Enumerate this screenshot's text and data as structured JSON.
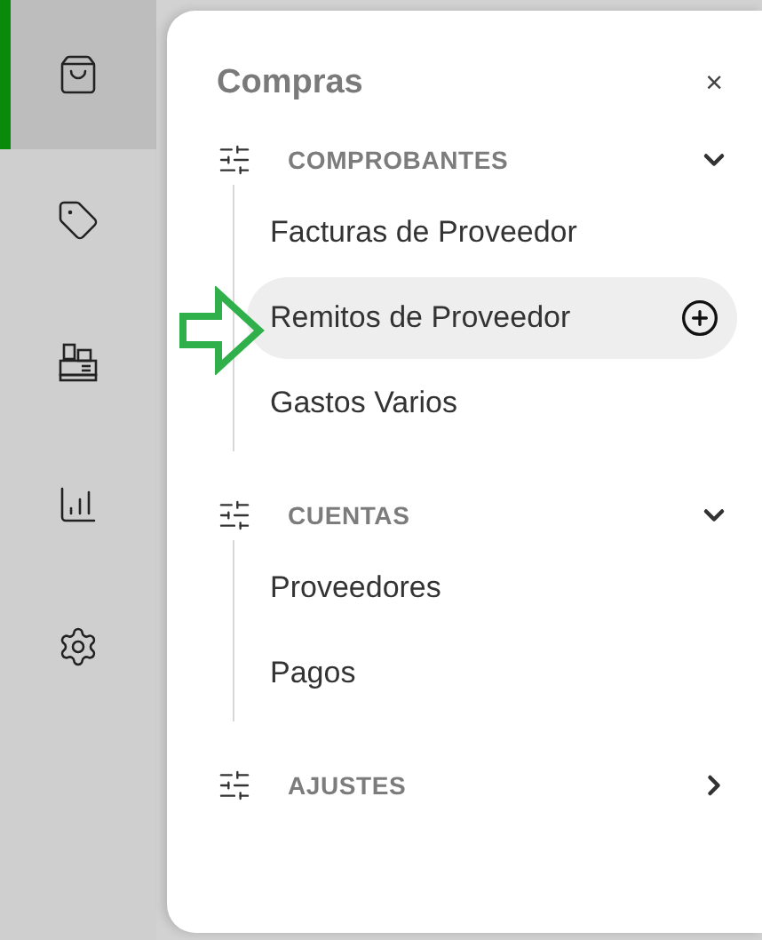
{
  "rail": [
    {
      "kind": "bag",
      "selected": true
    },
    {
      "kind": "tag",
      "selected": false
    },
    {
      "kind": "register",
      "selected": false
    },
    {
      "kind": "chart",
      "selected": false
    },
    {
      "kind": "settings",
      "selected": false
    }
  ],
  "panel": {
    "title": "Compras",
    "close": "×",
    "sections": [
      {
        "label": "COMPROBANTES",
        "expanded": true,
        "items": [
          {
            "label": "Facturas de Proveedor",
            "selected": false
          },
          {
            "label": "Remitos de Proveedor",
            "selected": true
          },
          {
            "label": "Gastos Varios",
            "selected": false
          }
        ]
      },
      {
        "label": "CUENTAS",
        "expanded": true,
        "items": [
          {
            "label": "Proveedores",
            "selected": false
          },
          {
            "label": "Pagos",
            "selected": false
          }
        ]
      },
      {
        "label": "AJUSTES",
        "expanded": false
      }
    ]
  }
}
